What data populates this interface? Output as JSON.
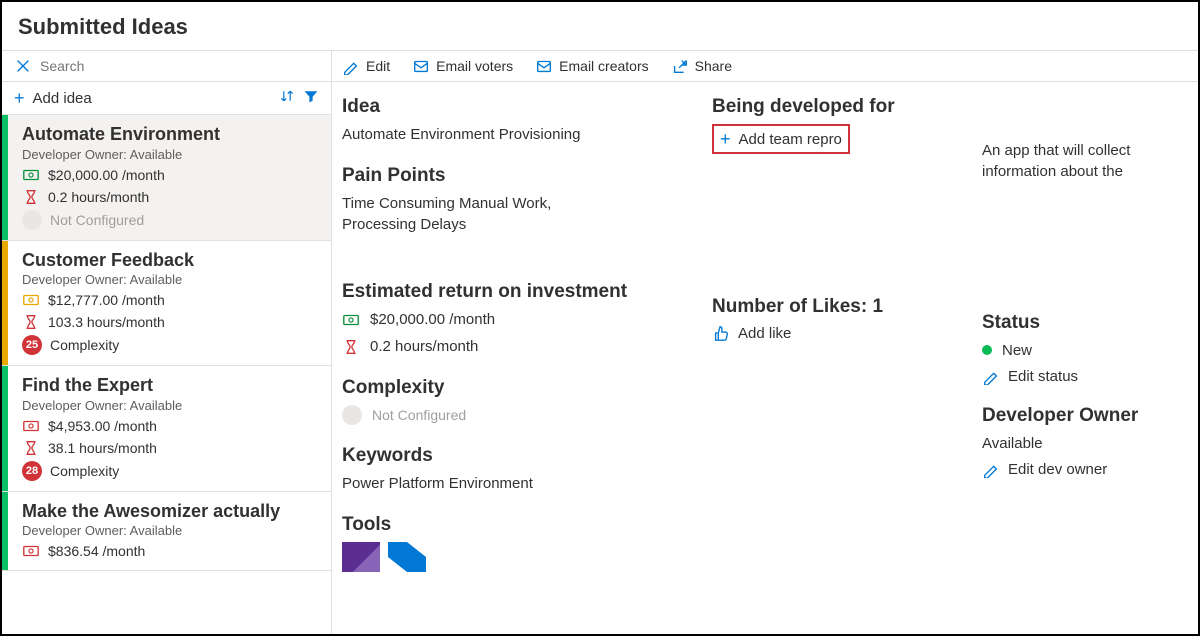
{
  "header": {
    "title": "Submitted Ideas"
  },
  "sidebar": {
    "search_placeholder": "Search",
    "add_idea_label": "Add idea",
    "items": [
      {
        "stripe": "green",
        "selected": true,
        "title": "Automate Environment",
        "owner_line": "Developer Owner: Available",
        "money": "$20,000.00 /month",
        "hours": "0.2 hours/month",
        "complexity_label": "Not Configured",
        "complexity_badge": "",
        "money_color": "green"
      },
      {
        "stripe": "yellow",
        "title": "Customer Feedback",
        "owner_line": "Developer Owner: Available",
        "money": "$12,777.00 /month",
        "hours": "103.3 hours/month",
        "complexity_label": "Complexity",
        "complexity_badge": "25",
        "money_color": "yellow"
      },
      {
        "stripe": "green",
        "title": "Find the Expert",
        "owner_line": "Developer Owner: Available",
        "money": "$4,953.00 /month",
        "hours": "38.1 hours/month",
        "complexity_label": "Complexity",
        "complexity_badge": "28",
        "money_color": "red"
      },
      {
        "stripe": "green",
        "title": "Make the Awesomizer actually",
        "owner_line": "Developer Owner: Available",
        "money": "$836.54 /month",
        "hours": "",
        "complexity_label": "",
        "complexity_badge": "",
        "money_color": "red"
      }
    ]
  },
  "toolbar": {
    "edit": "Edit",
    "email_voters": "Email voters",
    "email_creators": "Email creators",
    "share": "Share"
  },
  "detail": {
    "idea_heading": "Idea",
    "idea_value": "Automate Environment Provisioning",
    "pain_heading": "Pain Points",
    "pain_value": "Time Consuming Manual Work, Processing Delays",
    "roi_heading": "Estimated return on investment",
    "roi_money": "$20,000.00 /month",
    "roi_hours": "0.2 hours/month",
    "complexity_heading": "Complexity",
    "complexity_value": "Not Configured",
    "keywords_heading": "Keywords",
    "keywords_value": "Power Platform Environment",
    "tools_heading": "Tools",
    "developed_for_heading": "Being developed for",
    "add_team_repro": "Add team repro",
    "likes_heading": "Number of Likes: 1",
    "add_like": "Add like",
    "status_heading": "Status",
    "status_value": "New",
    "edit_status": "Edit status",
    "dev_owner_heading": "Developer Owner",
    "dev_owner_value": "Available",
    "edit_dev_owner": "Edit dev owner",
    "description": "An app that will collect information about the"
  }
}
